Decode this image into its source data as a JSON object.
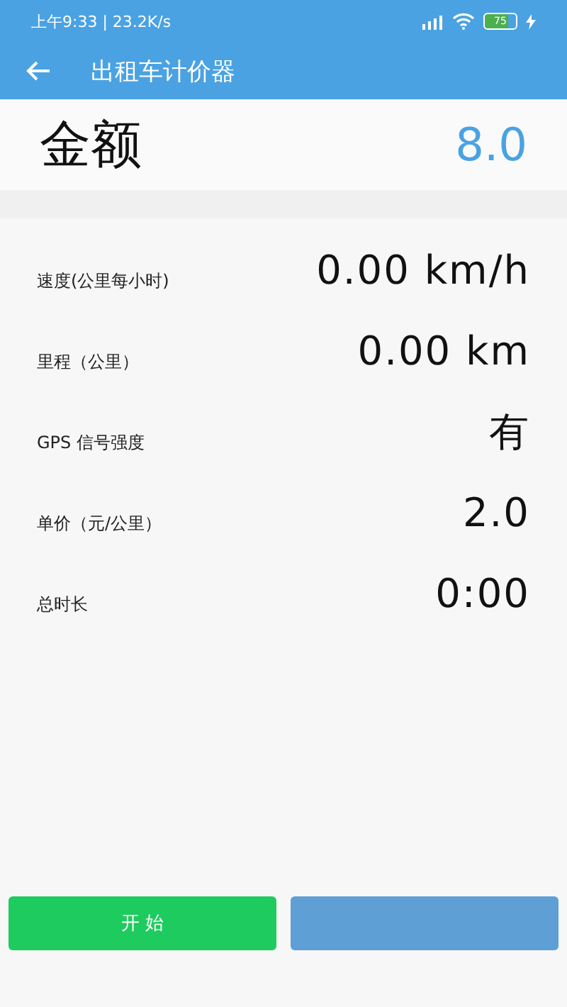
{
  "status_bar": {
    "time": "上午9:33 | 23.2K/s",
    "battery": "75"
  },
  "app_bar": {
    "title": "出租车计价器"
  },
  "amount": {
    "label": "金额",
    "value": "8.0"
  },
  "rows": [
    {
      "label": "速度(公里每小时)",
      "value": "0.00 km/h"
    },
    {
      "label": "里程（公里）",
      "value": "0.00 km"
    },
    {
      "label": "GPS 信号强度",
      "value": "有"
    },
    {
      "label": "单价（元/公里）",
      "value": "2.0"
    },
    {
      "label": "总时长",
      "value": "0:00"
    }
  ],
  "buttons": [
    {
      "label": "开 始",
      "kind": "start"
    },
    {
      "kind": "secondary"
    }
  ]
}
